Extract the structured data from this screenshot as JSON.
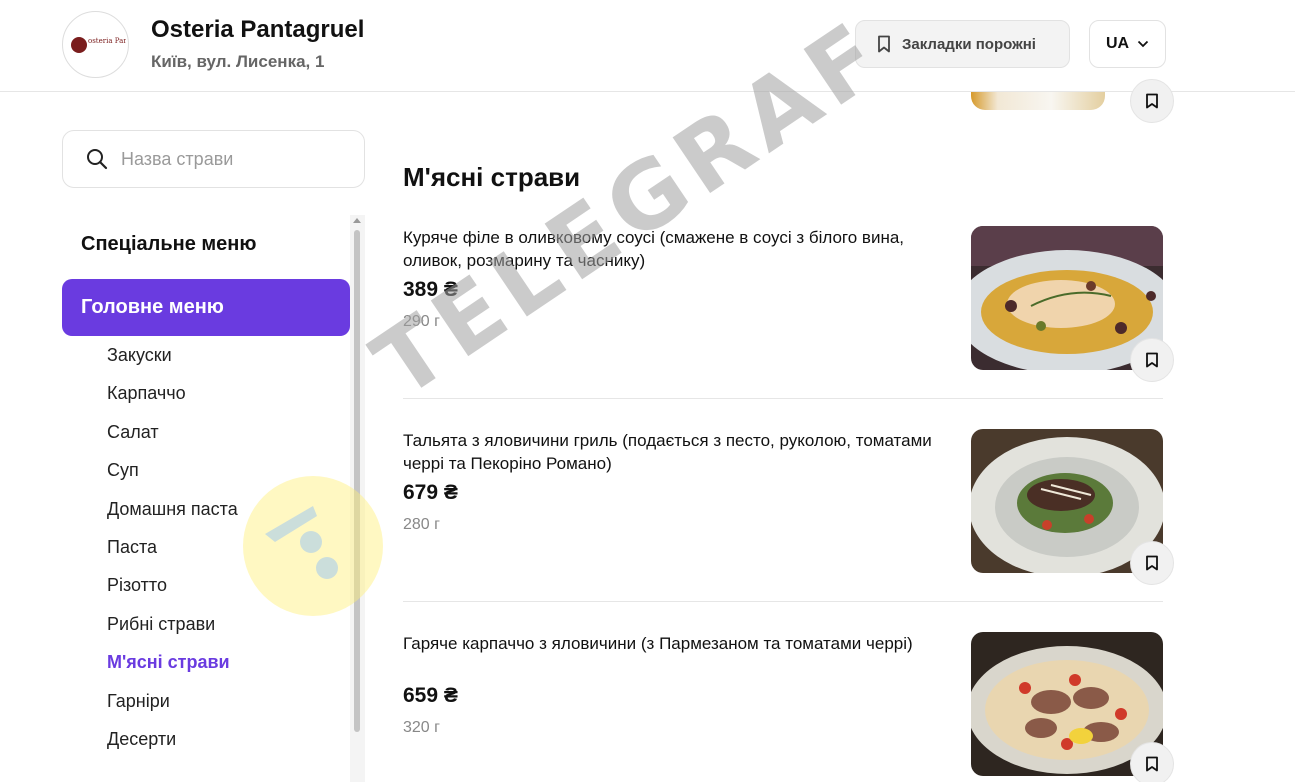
{
  "header": {
    "logo_text": "osteria Pantagruel",
    "restaurant_name": "Osteria Pantagruel",
    "address": "Київ, вул. Лисенка, 1",
    "bookmarks_label": "Закладки порожні",
    "language": "UA"
  },
  "search": {
    "placeholder": "Назва страви"
  },
  "sidebar": {
    "special_menu": "Спеціальне меню",
    "main_menu": "Головне меню",
    "categories": [
      "Закуски",
      "Карпаччо",
      "Салат",
      "Суп",
      "Домашня паста",
      "Паста",
      "Різотто",
      "Рибні страви",
      "М'ясні страви",
      "Гарніри",
      "Десерти"
    ],
    "active_category": "М'ясні страви"
  },
  "content": {
    "section_title": "М'ясні страви",
    "dishes": [
      {
        "name": "Куряче філе в оливковому соусі (смажене в соусі з білого вина, оливок, розмарину та часнику)",
        "price": "389 ₴",
        "weight": "290 г"
      },
      {
        "name": "Тальята з яловичини гриль (подається з песто, руколою, томатами черрі та Пекоріно Романо)",
        "price": "679 ₴",
        "weight": "280 г"
      },
      {
        "name": "Гаряче карпаччо з яловичини (з Пармезаном та томатами черрі)",
        "price": "659 ₴",
        "weight": "320 г"
      }
    ]
  },
  "watermark": "TELEGRAF",
  "colors": {
    "accent": "#6a3be0"
  }
}
